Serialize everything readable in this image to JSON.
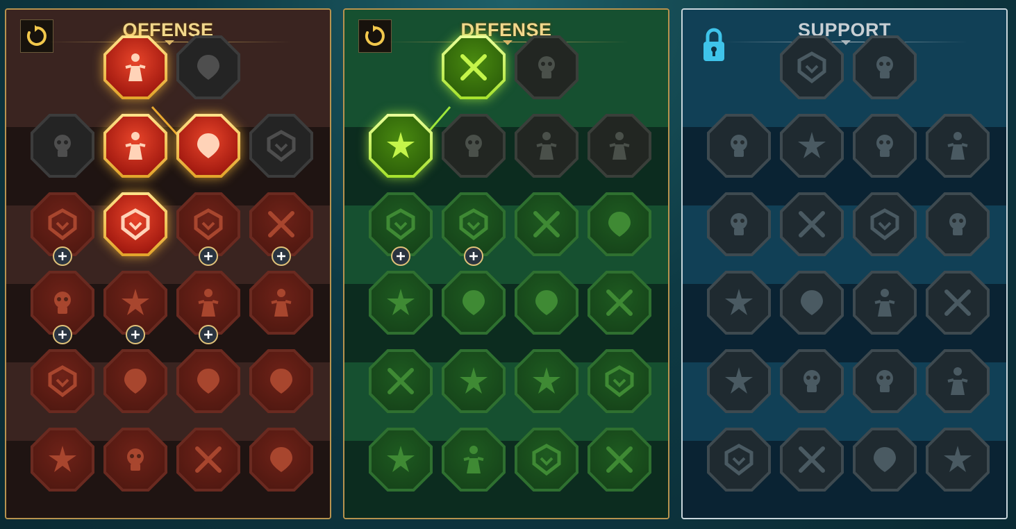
{
  "panels": {
    "offense": {
      "title": "OFFENSE",
      "accent": "#f2d88c"
    },
    "defense": {
      "title": "DEFENSE",
      "accent": "#f2d88c"
    },
    "support": {
      "title": "SUPPORT",
      "accent": "#c8cfd4",
      "locked": true
    }
  },
  "offense_nodes": [
    {
      "icon": "crossed-swords-icon",
      "state": "active"
    },
    {
      "icon": "dagger-slash-icon",
      "state": "locked"
    },
    {
      "icon": "horned-demon-heart-icon",
      "state": "locked"
    },
    {
      "icon": "flaming-sword-icon",
      "state": "active"
    },
    {
      "icon": "shattered-shield-icon",
      "state": "active"
    },
    {
      "icon": "bleeding-heart-icon",
      "state": "locked"
    },
    {
      "icon": "fist-strike-icon",
      "state": "available",
      "plus": true
    },
    {
      "icon": "fanged-mouth-icon",
      "state": "active"
    },
    {
      "icon": "skull-slash-icon",
      "state": "available",
      "plus": true
    },
    {
      "icon": "scythe-icon",
      "state": "available",
      "plus": true
    },
    {
      "icon": "dagger-heart-icon",
      "state": "available",
      "plus": true
    },
    {
      "icon": "gauntlet-fist-icon",
      "state": "available",
      "plus": true
    },
    {
      "icon": "axe-icon",
      "state": "available",
      "plus": true
    },
    {
      "icon": "chain-lightning-icon",
      "state": "available"
    },
    {
      "icon": "claw-slash-icon",
      "state": "available"
    },
    {
      "icon": "triple-skull-icon",
      "state": "available"
    },
    {
      "icon": "sword-circle-icon",
      "state": "available"
    },
    {
      "icon": "warrior-power-icon",
      "state": "available"
    },
    {
      "icon": "sword-hand-icon",
      "state": "available"
    },
    {
      "icon": "knight-helmet-icon",
      "state": "available"
    },
    {
      "icon": "horned-beast-icon",
      "state": "available"
    },
    {
      "icon": "spiked-skull-icon",
      "state": "available"
    }
  ],
  "defense_nodes": [
    {
      "icon": "scale-armor-icon",
      "state": "active"
    },
    {
      "icon": "raised-fist-icon",
      "state": "locked"
    },
    {
      "icon": "chevron-shield-icon",
      "state": "active"
    },
    {
      "icon": "armored-heart-icon",
      "state": "locked"
    },
    {
      "icon": "stone-golem-icon",
      "state": "locked"
    },
    {
      "icon": "deflect-blade-icon",
      "state": "locked"
    },
    {
      "icon": "dodging-figure-icon",
      "state": "available",
      "plus": true
    },
    {
      "icon": "knight-shield-icon",
      "state": "available",
      "plus": true
    },
    {
      "icon": "heart-skull-icon",
      "state": "available"
    },
    {
      "icon": "hooded-figure-icon",
      "state": "available"
    },
    {
      "icon": "crowd-icon",
      "state": "available"
    },
    {
      "icon": "hourglass-icon",
      "state": "available"
    },
    {
      "icon": "open-hand-icon",
      "state": "available"
    },
    {
      "icon": "bull-head-icon",
      "state": "available"
    },
    {
      "icon": "running-figure-icon",
      "state": "available"
    },
    {
      "icon": "droplets-icon",
      "state": "available"
    },
    {
      "icon": "radiant-skull-icon",
      "state": "available"
    },
    {
      "icon": "grasping-hand-icon",
      "state": "available"
    },
    {
      "icon": "spiked-warrior-icon",
      "state": "available"
    },
    {
      "icon": "winged-shield-icon",
      "state": "available"
    },
    {
      "icon": "bearded-skull-icon",
      "state": "available"
    },
    {
      "icon": "flexing-figure-icon",
      "state": "available"
    }
  ],
  "support_nodes": [
    {
      "icon": "heart-plus-icon",
      "state": "locked"
    },
    {
      "icon": "swirl-hand-icon",
      "state": "locked"
    },
    {
      "icon": "praying-hands-icon",
      "state": "locked"
    },
    {
      "icon": "rings-shield-icon",
      "state": "locked"
    },
    {
      "icon": "smoke-skull-icon",
      "state": "locked"
    },
    {
      "icon": "speed-boot-icon",
      "state": "locked"
    },
    {
      "icon": "sparkle-figure-icon",
      "state": "locked"
    },
    {
      "icon": "lightning-icon",
      "state": "locked"
    },
    {
      "icon": "cracked-legs-icon",
      "state": "locked"
    },
    {
      "icon": "shadow-figure-icon",
      "state": "locked"
    },
    {
      "icon": "chained-heart-icon",
      "state": "locked"
    },
    {
      "icon": "comet-icon",
      "state": "locked"
    },
    {
      "icon": "open-book-icon",
      "state": "locked"
    },
    {
      "icon": "angry-eyes-icon",
      "state": "locked"
    },
    {
      "icon": "compass-star-icon",
      "state": "locked"
    },
    {
      "icon": "fast-boot-icon",
      "state": "locked"
    },
    {
      "icon": "eye-icon",
      "state": "locked"
    },
    {
      "icon": "snake-icon",
      "state": "locked"
    },
    {
      "icon": "potion-icon",
      "state": "locked"
    },
    {
      "icon": "horned-skull-icon",
      "state": "locked"
    },
    {
      "icon": "claw-fist-icon",
      "state": "locked"
    },
    {
      "icon": "eagle-head-icon",
      "state": "locked"
    }
  ]
}
